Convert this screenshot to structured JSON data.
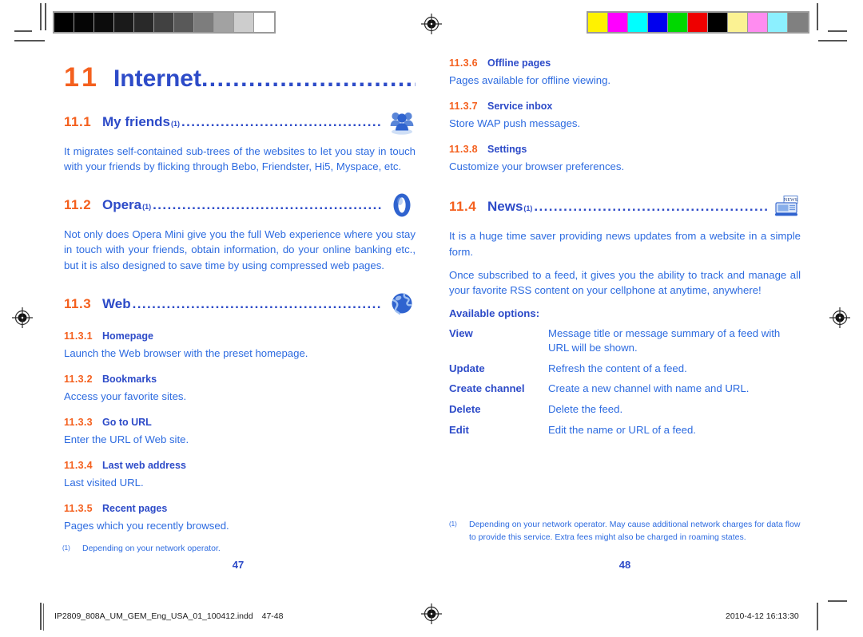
{
  "document": {
    "left_page": {
      "chapter": {
        "number": "11",
        "title": "Internet",
        "leader": "................................"
      },
      "sections": [
        {
          "number": "11.1",
          "title": "My friends",
          "footnote_ref": "(1)",
          "leader": ".................................................",
          "icon": "friends-icon",
          "body": "It migrates self-contained sub-trees of the websites to let you stay in touch with your friends by flicking through Bebo, Friendster, Hi5, Myspace, etc."
        },
        {
          "number": "11.2",
          "title": "Opera",
          "footnote_ref": "(1)",
          "leader": "......................................................",
          "icon": "opera-icon",
          "body": "Not only does Opera Mini give you the full Web experience where you stay in touch with your friends, obtain information, do your online banking etc., but it is also designed to save time by using compressed web pages."
        },
        {
          "number": "11.3",
          "title": "Web",
          "footnote_ref": "",
          "leader": "............................................................",
          "icon": "globe-icon",
          "body": ""
        }
      ],
      "subsections": [
        {
          "number": "11.3.1",
          "title": "Homepage",
          "body": "Launch the Web browser with the preset homepage."
        },
        {
          "number": "11.3.2",
          "title": "Bookmarks",
          "body": "Access your favorite sites."
        },
        {
          "number": "11.3.3",
          "title": "Go to URL",
          "body": "Enter the URL of Web site."
        },
        {
          "number": "11.3.4",
          "title": "Last web address",
          "body": "Last visited URL."
        },
        {
          "number": "11.3.5",
          "title": "Recent pages",
          "body": "Pages which you recently browsed."
        }
      ],
      "footnote": {
        "mark": "(1)",
        "text": "Depending on your network operator."
      },
      "page_number": "47"
    },
    "right_page": {
      "subsections": [
        {
          "number": "11.3.6",
          "title": "Offline pages",
          "body": "Pages available for offline viewing."
        },
        {
          "number": "11.3.7",
          "title": "Service inbox",
          "body": "Store WAP push messages."
        },
        {
          "number": "11.3.8",
          "title": "Settings",
          "body": "Customize your browser preferences."
        }
      ],
      "section": {
        "number": "11.4",
        "title": "News",
        "footnote_ref": "(1)",
        "leader": ".......................................................",
        "icon": "news-icon",
        "body1": "It is a huge time saver providing news updates from a website in a simple form.",
        "body2": "Once subscribed to a feed, it gives you the ability to track and manage all your favorite RSS content on your cellphone at anytime, anywhere!"
      },
      "available_options_label": "Available options:",
      "options": [
        {
          "key": "View",
          "desc": "Message title or message summary of a feed with URL will be shown."
        },
        {
          "key": "Update",
          "desc": "Refresh the content of a feed."
        },
        {
          "key": "Create channel",
          "desc": "Create a new channel with name and URL."
        },
        {
          "key": "Delete",
          "desc": "Delete the feed."
        },
        {
          "key": "Edit",
          "desc": "Edit the name or URL of a feed."
        }
      ],
      "footnote": {
        "mark": "(1)",
        "text": "Depending on your network operator. May cause additional network charges for data flow to provide this service. Extra fees might also be charged in roaming states."
      },
      "page_number": "48"
    }
  },
  "print_marks": {
    "grayscale_patches": [
      "#000000",
      "#050505",
      "#0c0c0c",
      "#1a1a1a",
      "#292929",
      "#414141",
      "#595959",
      "#7d7d7d",
      "#a2a2a2",
      "#cdcdcd",
      "#ffffff"
    ],
    "color_patches": [
      "#fff200",
      "#ff00ff",
      "#00ffff",
      "#0000ee",
      "#00d800",
      "#ee0000",
      "#000000",
      "#fbf293",
      "#ff8cf0",
      "#8cf0ff",
      "#808080"
    ],
    "registration_icon": "registration-target-icon"
  },
  "slug": {
    "filename": "IP2809_808A_UM_GEM_Eng_USA_01_100412.indd",
    "pages": "47-48",
    "timestamp": "2010-4-12   16:13:30"
  },
  "colors": {
    "heading_blue": "#2D4BC8",
    "body_blue": "#2D6BE0",
    "accent_orange": "#F4601E"
  }
}
